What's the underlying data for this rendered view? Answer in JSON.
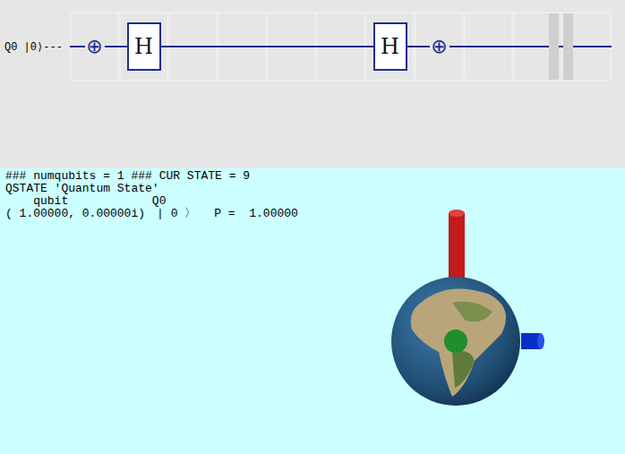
{
  "circuit": {
    "qubits": [
      {
        "label": "Q0 |0⟩---",
        "cells": [
          {
            "kind": "x",
            "symbol": "⊕"
          },
          {
            "kind": "h",
            "symbol": "H"
          },
          {
            "kind": "empty",
            "symbol": ""
          },
          {
            "kind": "empty",
            "symbol": ""
          },
          {
            "kind": "empty",
            "symbol": ""
          },
          {
            "kind": "empty",
            "symbol": ""
          },
          {
            "kind": "h",
            "symbol": "H"
          },
          {
            "kind": "x",
            "symbol": "⊕"
          },
          {
            "kind": "empty",
            "symbol": ""
          },
          {
            "kind": "barrier",
            "symbol": ""
          },
          {
            "kind": "empty",
            "symbol": ""
          }
        ]
      }
    ]
  },
  "output": {
    "header": "### numqubits = 1 ### CUR STATE = 9",
    "title": "QSTATE 'Quantum State'",
    "column_header": "    qubit            Q0",
    "rows": [
      {
        "amplitude": "( 1.00000, 0.00000i)",
        "ket": "| 0 〉",
        "probability": "P =  1.00000"
      }
    ]
  }
}
